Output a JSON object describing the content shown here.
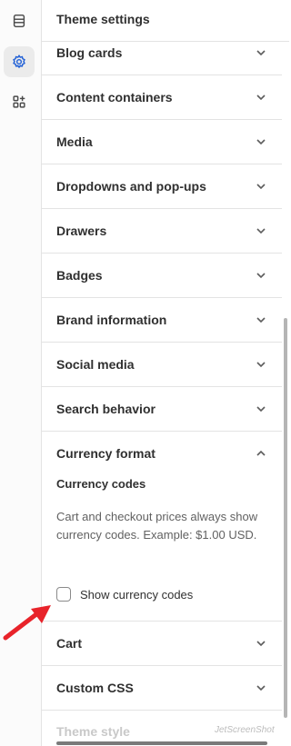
{
  "rail": {
    "items": [
      {
        "icon": "sections-icon",
        "active": false
      },
      {
        "icon": "gear-icon",
        "active": true
      },
      {
        "icon": "apps-icon",
        "active": false
      }
    ]
  },
  "panel": {
    "title": "Theme settings",
    "sections": [
      {
        "label": "Blog cards"
      },
      {
        "label": "Content containers"
      },
      {
        "label": "Media"
      },
      {
        "label": "Dropdowns and pop-ups"
      },
      {
        "label": "Drawers"
      },
      {
        "label": "Badges"
      },
      {
        "label": "Brand information"
      },
      {
        "label": "Social media"
      },
      {
        "label": "Search behavior"
      }
    ],
    "expanded": {
      "label": "Currency format",
      "sub_heading": "Currency codes",
      "help_text": "Cart and checkout prices always show currency codes. Example: $1.00 USD.",
      "checkbox_label": "Show currency codes",
      "checked": false
    },
    "sections_after": [
      {
        "label": "Cart"
      },
      {
        "label": "Custom CSS"
      }
    ],
    "faded_label": "Theme style"
  },
  "watermark": "JetScreenShot",
  "colors": {
    "annotation_arrow": "#e8232a",
    "border": "#e3e3e3",
    "text": "#303030"
  }
}
